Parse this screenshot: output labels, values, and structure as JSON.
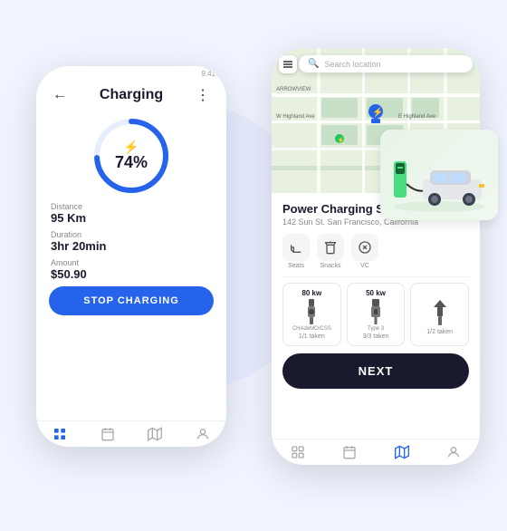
{
  "scene": {
    "bg_circle": true
  },
  "left_phone": {
    "header": {
      "back": "←",
      "title": "Charging",
      "more": "⋮"
    },
    "charging": {
      "percent": "74%",
      "bolt": "⚡"
    },
    "stats": [
      {
        "label": "Distance",
        "value": "95 Km"
      },
      {
        "label": "Duration",
        "value": "3hr 20min"
      },
      {
        "label": "Amount",
        "value": "$50.90"
      }
    ],
    "stop_button": "STOP CHARGING",
    "nav": [
      {
        "icon": "⊟",
        "label": "",
        "active": true
      },
      {
        "icon": "☰",
        "label": "",
        "active": false
      },
      {
        "icon": "⊕",
        "label": "",
        "active": false
      },
      {
        "icon": "👤",
        "label": "",
        "active": false
      }
    ]
  },
  "right_phone": {
    "map": {
      "search_placeholder": "Search location",
      "road_labels": [
        "ARROWVIEW",
        "W Highland Ave",
        "E Highland Ave"
      ]
    },
    "station": {
      "name": "Power Charging Station",
      "address": "142 Sun St. San Francisco, California"
    },
    "amenities": [
      {
        "icon": "☕",
        "label": "Seats"
      },
      {
        "icon": "🥤",
        "label": "Snacks"
      },
      {
        "icon": "🔌",
        "label": "VC"
      }
    ],
    "charger_types": [
      {
        "kw": "80 kw",
        "name": "CHAdeMO/CSS",
        "availability": "1/1 taken",
        "icon": "⚡"
      },
      {
        "kw": "50 kw",
        "name": "Type 3",
        "availability": "3/3 taken",
        "icon": "⚡"
      },
      {
        "kw": "",
        "name": "",
        "availability": "1/2 taken",
        "icon": "⚡"
      }
    ],
    "next_button": "NEXT",
    "nav": [
      {
        "icon": "⊟",
        "label": "",
        "active": false
      },
      {
        "icon": "☰",
        "label": "",
        "active": false
      },
      {
        "icon": "🗺",
        "label": "",
        "active": true
      },
      {
        "icon": "👤",
        "label": "",
        "active": false
      }
    ]
  }
}
